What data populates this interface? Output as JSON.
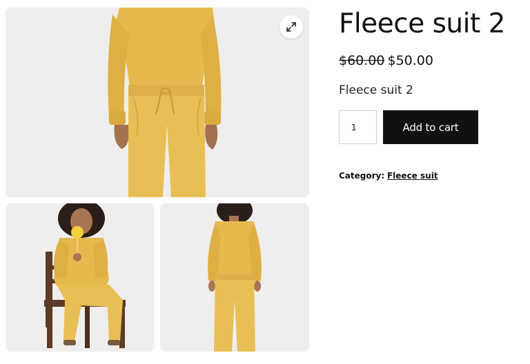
{
  "product": {
    "title": "Fleece suit 2",
    "price_old": "$60.00",
    "price_new": "$50.00",
    "short_description": "Fleece suit 2",
    "quantity": "1",
    "add_to_cart_label": "Add to cart",
    "category_label": "Category:",
    "category_link": "Fleece suit"
  },
  "gallery": {
    "zoom_icon": "expand-icon",
    "images": [
      {
        "view": "front-closeup"
      },
      {
        "view": "seated-front"
      },
      {
        "view": "standing-back"
      }
    ]
  },
  "colors": {
    "fleece": "#e8bf55",
    "button_bg": "#111111",
    "image_bg": "#ececeb"
  }
}
